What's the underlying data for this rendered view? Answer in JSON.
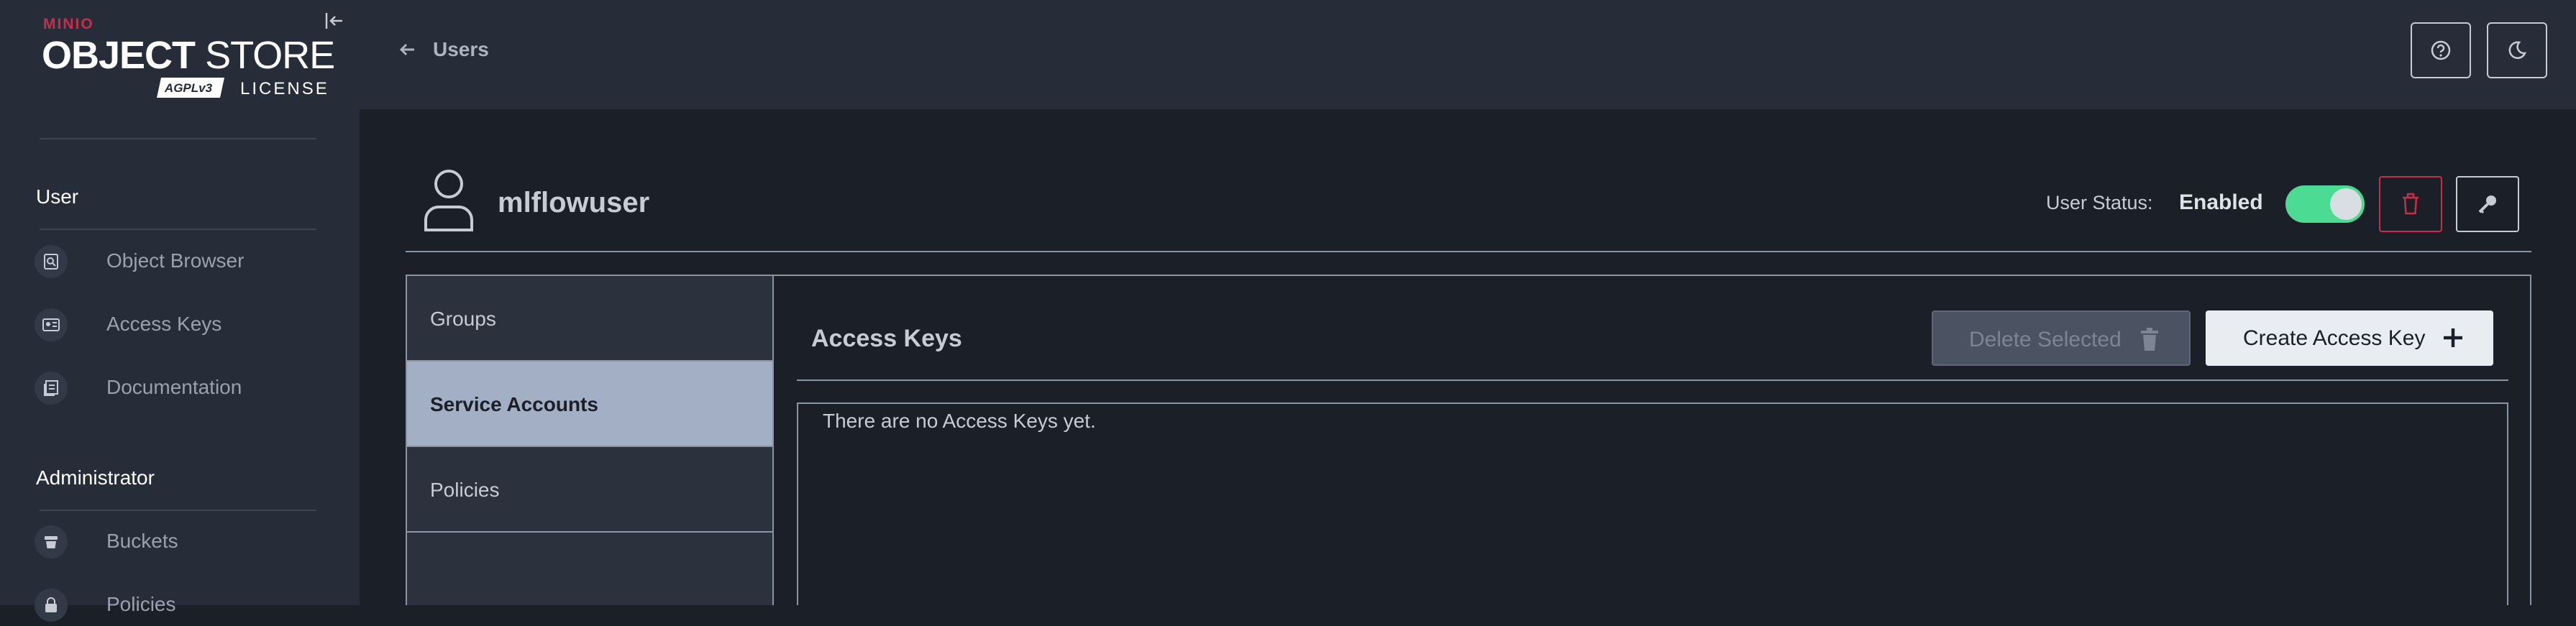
{
  "brand": {
    "small": "MINIO",
    "product_bold": "OBJECT",
    "product_light": "STORE",
    "badge": "AGPLv3",
    "license": "LICENSE"
  },
  "sidebar": {
    "sections": [
      {
        "title": "User",
        "items": [
          {
            "label": "Object Browser",
            "icon": "object-browser-icon"
          },
          {
            "label": "Access Keys",
            "icon": "access-keys-icon"
          },
          {
            "label": "Documentation",
            "icon": "documentation-icon"
          }
        ]
      },
      {
        "title": "Administrator",
        "items": [
          {
            "label": "Buckets",
            "icon": "buckets-icon"
          },
          {
            "label": "Policies",
            "icon": "policies-icon"
          }
        ]
      }
    ]
  },
  "topbar": {
    "back_label": "Users",
    "help_icon": "help-icon",
    "theme_icon": "dark-mode-icon"
  },
  "user": {
    "name": "mlflowuser",
    "status_label": "User Status:",
    "status_value": "Enabled",
    "status_enabled": true
  },
  "tabs": [
    {
      "label": "Groups",
      "active": false
    },
    {
      "label": "Service Accounts",
      "active": true
    },
    {
      "label": "Policies",
      "active": false
    }
  ],
  "access_keys": {
    "title": "Access Keys",
    "delete_label": "Delete Selected",
    "create_label": "Create Access Key",
    "empty_message": "There are no Access Keys yet."
  },
  "colors": {
    "accent_toggle": "#4cdb93",
    "danger": "#c72e49",
    "sidebar_bg": "#262c38",
    "page_bg": "#1b1f27",
    "active_tab": "#a3afc4"
  }
}
